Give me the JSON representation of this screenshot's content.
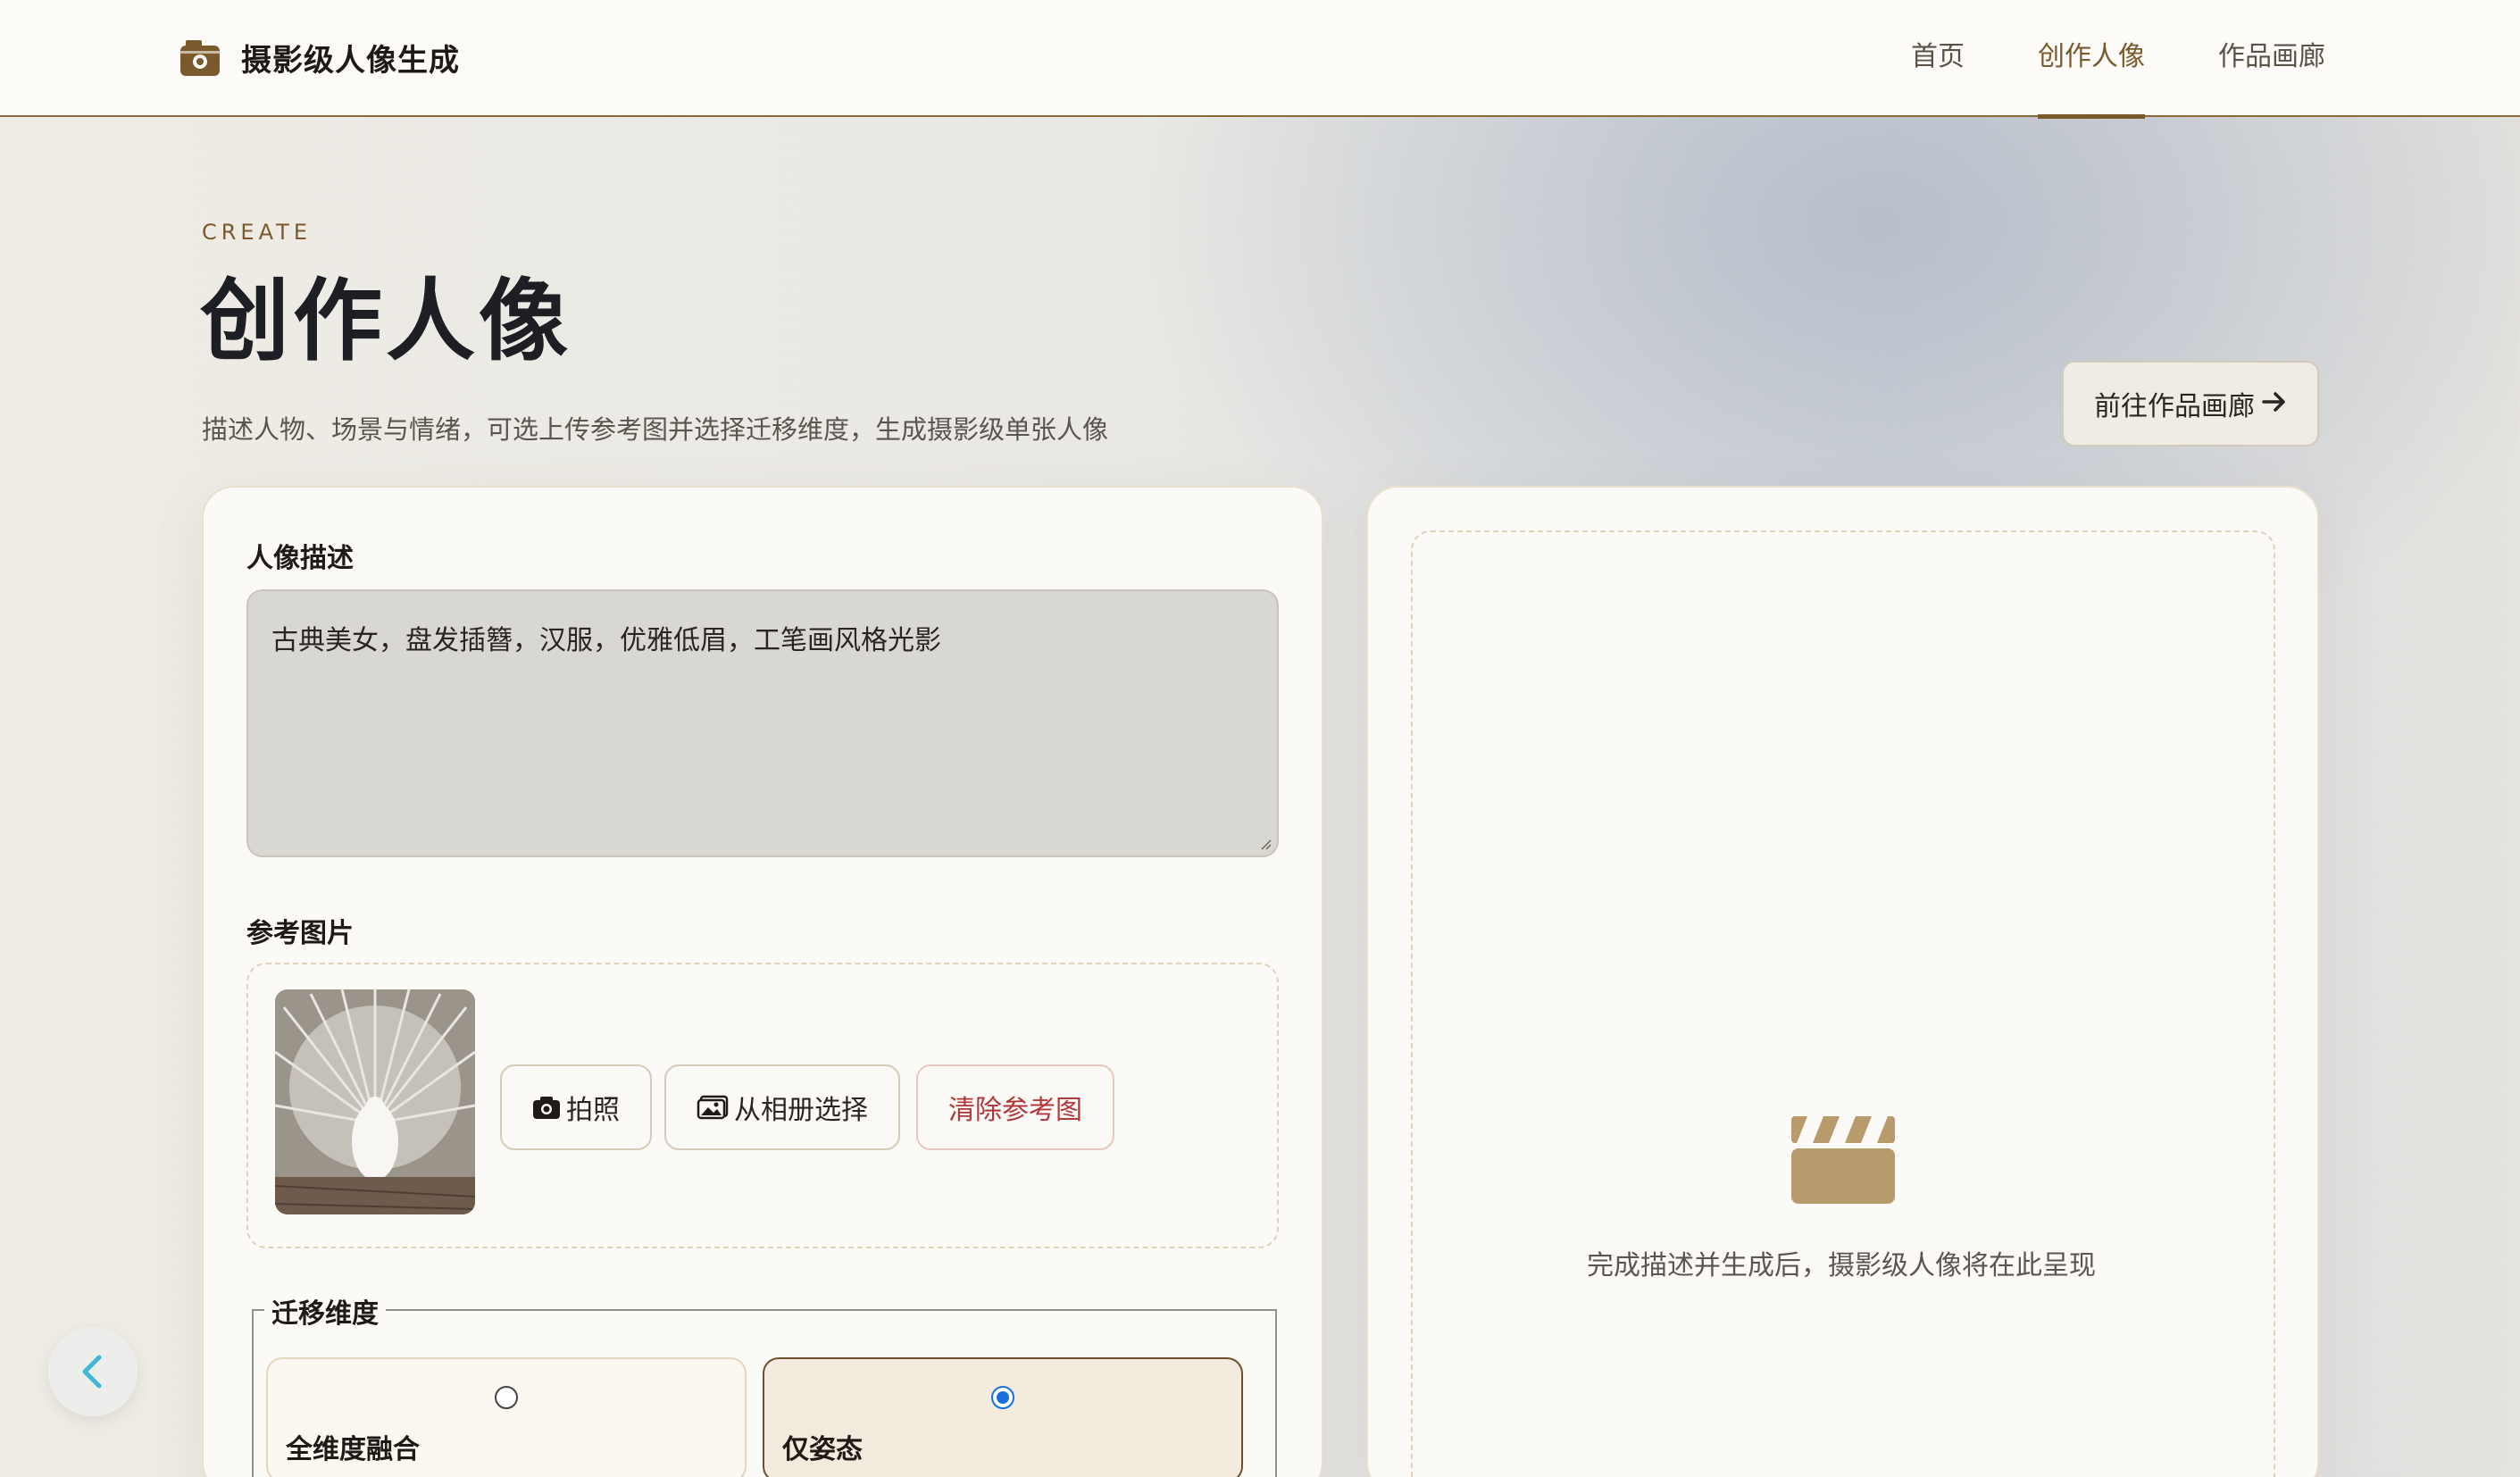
{
  "header": {
    "brand_title": "摄影级人像生成",
    "nav": [
      {
        "label": "首页",
        "active": false
      },
      {
        "label": "创作人像",
        "active": true
      },
      {
        "label": "作品画廊",
        "active": false
      }
    ]
  },
  "page": {
    "eyebrow": "CREATE",
    "title": "创作人像",
    "subtitle": "描述人物、场景与情绪，可选上传参考图并选择迁移维度，生成摄影级单张人像",
    "gallery_button": "前往作品画廊"
  },
  "form": {
    "description_label": "人像描述",
    "description_value": "古典美女，盘发插簪，汉服，优雅低眉，工笔画风格光影",
    "reference_label": "参考图片",
    "buttons": {
      "camera": "拍照",
      "album": "从相册选择",
      "clear": "清除参考图"
    },
    "transfer_legend": "迁移维度",
    "transfer_options": [
      {
        "label": "全维度融合",
        "selected": false
      },
      {
        "label": "仅姿态",
        "selected": true
      }
    ]
  },
  "preview": {
    "hint": "完成描述并生成后，摄影级人像将在此呈现"
  },
  "colors": {
    "accent": "#7a5a2c",
    "danger": "#b0373a",
    "radio_checked": "#1a6fe0"
  },
  "icons": {
    "brand": "camera-icon",
    "camera_button": "camera-icon",
    "album_button": "image-icon",
    "preview": "clapperboard-icon",
    "back": "chevron-left-icon"
  }
}
